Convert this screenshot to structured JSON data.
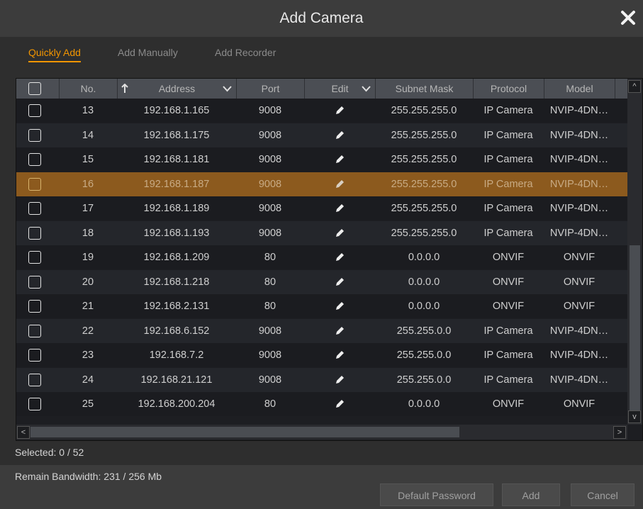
{
  "dialog": {
    "title": "Add Camera"
  },
  "tabs": [
    {
      "label": "Quickly Add",
      "active": true
    },
    {
      "label": "Add Manually",
      "active": false
    },
    {
      "label": "Add Recorder",
      "active": false
    }
  ],
  "table": {
    "columns": [
      "No.",
      "Address",
      "Port",
      "Edit",
      "Subnet Mask",
      "Protocol",
      "Model"
    ],
    "sort": {
      "column": "Address",
      "direction": "ascending"
    },
    "rows": [
      {
        "no": "13",
        "address": "192.168.1.165",
        "port": "9008",
        "subnet": "255.255.255.0",
        "protocol": "IP Camera",
        "model": "NVIP-4DN…",
        "checked": false,
        "highlighted": false
      },
      {
        "no": "14",
        "address": "192.168.1.175",
        "port": "9008",
        "subnet": "255.255.255.0",
        "protocol": "IP Camera",
        "model": "NVIP-4DN…",
        "checked": false,
        "highlighted": false
      },
      {
        "no": "15",
        "address": "192.168.1.181",
        "port": "9008",
        "subnet": "255.255.255.0",
        "protocol": "IP Camera",
        "model": "NVIP-4DN…",
        "checked": false,
        "highlighted": false
      },
      {
        "no": "16",
        "address": "192.168.1.187",
        "port": "9008",
        "subnet": "255.255.255.0",
        "protocol": "IP Camera",
        "model": "NVIP-4DN…",
        "checked": false,
        "highlighted": true
      },
      {
        "no": "17",
        "address": "192.168.1.189",
        "port": "9008",
        "subnet": "255.255.255.0",
        "protocol": "IP Camera",
        "model": "NVIP-4DN…",
        "checked": false,
        "highlighted": false
      },
      {
        "no": "18",
        "address": "192.168.1.193",
        "port": "9008",
        "subnet": "255.255.255.0",
        "protocol": "IP Camera",
        "model": "NVIP-4DN…",
        "checked": false,
        "highlighted": false
      },
      {
        "no": "19",
        "address": "192.168.1.209",
        "port": "80",
        "subnet": "0.0.0.0",
        "protocol": "ONVIF",
        "model": "ONVIF",
        "checked": false,
        "highlighted": false
      },
      {
        "no": "20",
        "address": "192.168.1.218",
        "port": "80",
        "subnet": "0.0.0.0",
        "protocol": "ONVIF",
        "model": "ONVIF",
        "checked": false,
        "highlighted": false
      },
      {
        "no": "21",
        "address": "192.168.2.131",
        "port": "80",
        "subnet": "0.0.0.0",
        "protocol": "ONVIF",
        "model": "ONVIF",
        "checked": false,
        "highlighted": false
      },
      {
        "no": "22",
        "address": "192.168.6.152",
        "port": "9008",
        "subnet": "255.255.0.0",
        "protocol": "IP Camera",
        "model": "NVIP-4DN…",
        "checked": false,
        "highlighted": false
      },
      {
        "no": "23",
        "address": "192.168.7.2",
        "port": "9008",
        "subnet": "255.255.0.0",
        "protocol": "IP Camera",
        "model": "NVIP-4DN…",
        "checked": false,
        "highlighted": false
      },
      {
        "no": "24",
        "address": "192.168.21.121",
        "port": "9008",
        "subnet": "255.255.0.0",
        "protocol": "IP Camera",
        "model": "NVIP-4DN…",
        "checked": false,
        "highlighted": false
      },
      {
        "no": "25",
        "address": "192.168.200.204",
        "port": "80",
        "subnet": "0.0.0.0",
        "protocol": "ONVIF",
        "model": "ONVIF",
        "checked": false,
        "highlighted": false
      }
    ]
  },
  "status": {
    "selected": "Selected: 0 / 52",
    "bandwidth": "Remain Bandwidth: 231 / 256 Mb"
  },
  "buttons": {
    "default_password": "Default Password",
    "add": "Add",
    "cancel": "Cancel"
  },
  "icons": {
    "close": "close-icon",
    "edit": "pencil-icon",
    "sort": "sort-up-arrow-icon",
    "dropdown": "chevron-down-icon"
  },
  "colors": {
    "accent": "#f29500",
    "highlight_row": "#8c5a1e",
    "title_bar": "#3c3c3c"
  }
}
